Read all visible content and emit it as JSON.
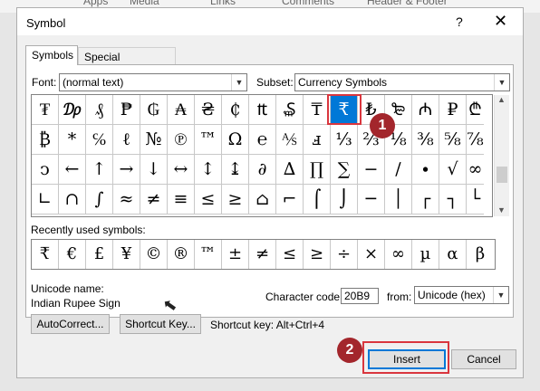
{
  "ribbon": {
    "tabs": [
      "Apps",
      "Media",
      "Links",
      "Comments",
      "Header & Footer"
    ]
  },
  "dialog": {
    "title": "Symbol",
    "help_label": "?",
    "close_label": "✕",
    "tabs": {
      "symbols": "Symbols",
      "special_characters": "Special Characters"
    },
    "font_label": "Font:",
    "font_value": "(normal text)",
    "subset_label": "Subset:",
    "subset_value": "Currency Symbols",
    "symbols": [
      [
        "₮",
        "₯",
        "₰",
        "₱",
        "₲",
        "₳",
        "₴",
        "₵",
        "₶",
        "₷",
        "₸",
        "₹",
        "₺",
        "₻",
        "₼",
        "₽",
        "₾"
      ],
      [
        "₿",
        "*",
        "℅",
        "ℓ",
        "№",
        "℗",
        "™",
        "Ω",
        "℮",
        "⅍",
        "ⅎ",
        "⅓",
        "⅔",
        "⅛",
        "⅜",
        "⅝",
        "⅞"
      ],
      [
        "ↄ",
        "←",
        "↑",
        "→",
        "↓",
        "↔",
        "↕",
        "↨",
        "∂",
        "∆",
        "∏",
        "∑",
        "−",
        "∕",
        "∙",
        "√",
        "∞"
      ],
      [
        "∟",
        "∩",
        "∫",
        "≈",
        "≠",
        "≡",
        "≤",
        "≥",
        "⌂",
        "⌐",
        "⌠",
        "⌡",
        "─",
        "│",
        "┌",
        "┐",
        "└"
      ]
    ],
    "recent_label": "Recently used symbols:",
    "recent_symbols": [
      "₹",
      "€",
      "£",
      "¥",
      "©",
      "®",
      "™",
      "±",
      "≠",
      "≤",
      "≥",
      "÷",
      "×",
      "∞",
      "µ",
      "α",
      "β"
    ],
    "unicode_name_label": "Unicode name:",
    "unicode_name_value": "Indian Rupee Sign",
    "char_code_label": "Character code:",
    "char_code_value": "20B9",
    "from_label": "from:",
    "from_value": "Unicode (hex)",
    "autocorrect_label": "AutoCorrect...",
    "shortcut_key_button": "Shortcut Key...",
    "shortcut_key_text": "Shortcut key: Alt+Ctrl+4",
    "insert_label": "Insert",
    "cancel_label": "Cancel"
  },
  "annotations": {
    "marker1": "1",
    "marker2": "2",
    "color": "#d9363e"
  }
}
